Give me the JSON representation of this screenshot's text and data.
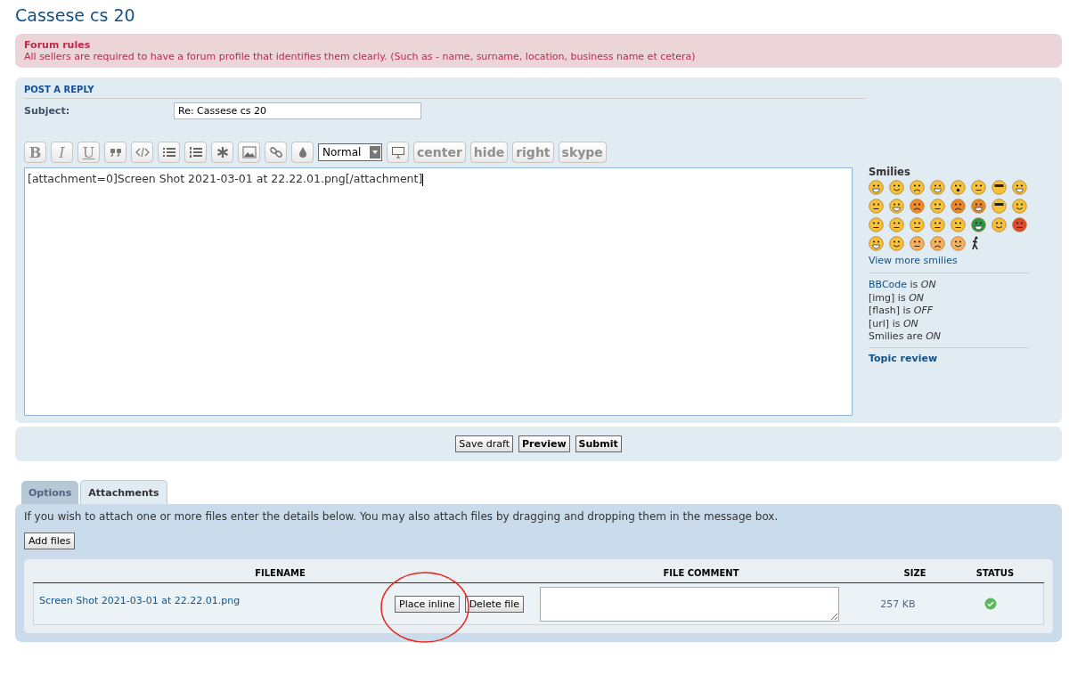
{
  "page_title": "Cassese cs 20",
  "forum_rules": {
    "title": "Forum rules",
    "text": "All sellers are required to have a forum profile that identifies them clearly. (Such as - name, surname, location, business name et cetera)"
  },
  "post": {
    "heading": "POST A REPLY",
    "subject_label": "Subject:",
    "subject_value": "Re: Cassese cs 20",
    "toolbar": [
      {
        "kind": "letter",
        "text": "B"
      },
      {
        "kind": "letter",
        "text": "I"
      },
      {
        "kind": "letter",
        "text": "U"
      },
      {
        "kind": "icon"
      },
      {
        "kind": "icon"
      },
      {
        "kind": "icon"
      },
      {
        "kind": "icon"
      },
      {
        "kind": "icon"
      },
      {
        "kind": "icon"
      },
      {
        "kind": "icon"
      },
      {
        "kind": "icon"
      },
      {
        "kind": "select",
        "text": "Normal"
      },
      {
        "kind": "icon"
      },
      {
        "kind": "word",
        "text": "center"
      },
      {
        "kind": "word",
        "text": "hide"
      },
      {
        "kind": "word",
        "text": "right"
      },
      {
        "kind": "word",
        "text": "skype"
      }
    ],
    "message": "[attachment=0]Screen Shot 2021-03-01 at 22.22.01.png[/attachment]",
    "smilies_title": "Smilies",
    "view_more": "View more smilies",
    "flags": [
      {
        "kind": "link",
        "name": "BBCode",
        "rest": "is",
        "value": "ON"
      },
      {
        "kind": "plain",
        "name": "[img] is",
        "value": "ON"
      },
      {
        "kind": "plain",
        "name": "[flash] is",
        "value": "OFF"
      },
      {
        "kind": "plain",
        "name": "[url] is",
        "value": "ON"
      },
      {
        "kind": "plain",
        "name": "Smilies are",
        "value": "ON"
      }
    ],
    "topic_review": "Topic review"
  },
  "buttons": [
    {
      "label": "Save draft",
      "primary": false
    },
    {
      "label": "Preview",
      "primary": true
    },
    {
      "label": "Submit",
      "primary": true
    }
  ],
  "tabs": [
    {
      "label": "Options",
      "selected": false
    },
    {
      "label": "Attachments",
      "selected": true
    }
  ],
  "attachments": {
    "intro": "If you wish to attach one or more files enter the details below. You may also attach files by dragging and dropping them in the message box.",
    "add_button": "Add files",
    "columns": [
      "FILENAME",
      "FILE COMMENT",
      "SIZE",
      "STATUS"
    ],
    "files": [
      {
        "filename": "Screen Shot 2021-03-01 at 22.22.01.png",
        "place_button": "Place inline",
        "delete_button": "Delete file",
        "size": "257 KB",
        "uploaded": true
      }
    ]
  }
}
